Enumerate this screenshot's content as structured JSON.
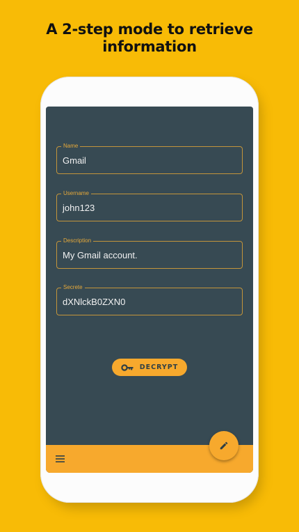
{
  "headline": {
    "line1": "A 2-step mode to retrieve",
    "line2": "information"
  },
  "form": {
    "fields": [
      {
        "label": "Name",
        "value": "Gmail"
      },
      {
        "label": "Username",
        "value": "john123"
      },
      {
        "label": "Description",
        "value": "My Gmail account."
      },
      {
        "label": "Secrete",
        "value": "dXNlckB0ZXN0"
      }
    ]
  },
  "actions": {
    "decrypt_label": "DECRYPT",
    "decrypt_icon": "key-icon",
    "fab_icon": "pencil-icon",
    "menu_icon": "hamburger-menu-icon"
  },
  "colors": {
    "background": "#f8bb06",
    "screen": "#374a53",
    "accent": "#f7a92d",
    "field_border": "#c4953b"
  }
}
